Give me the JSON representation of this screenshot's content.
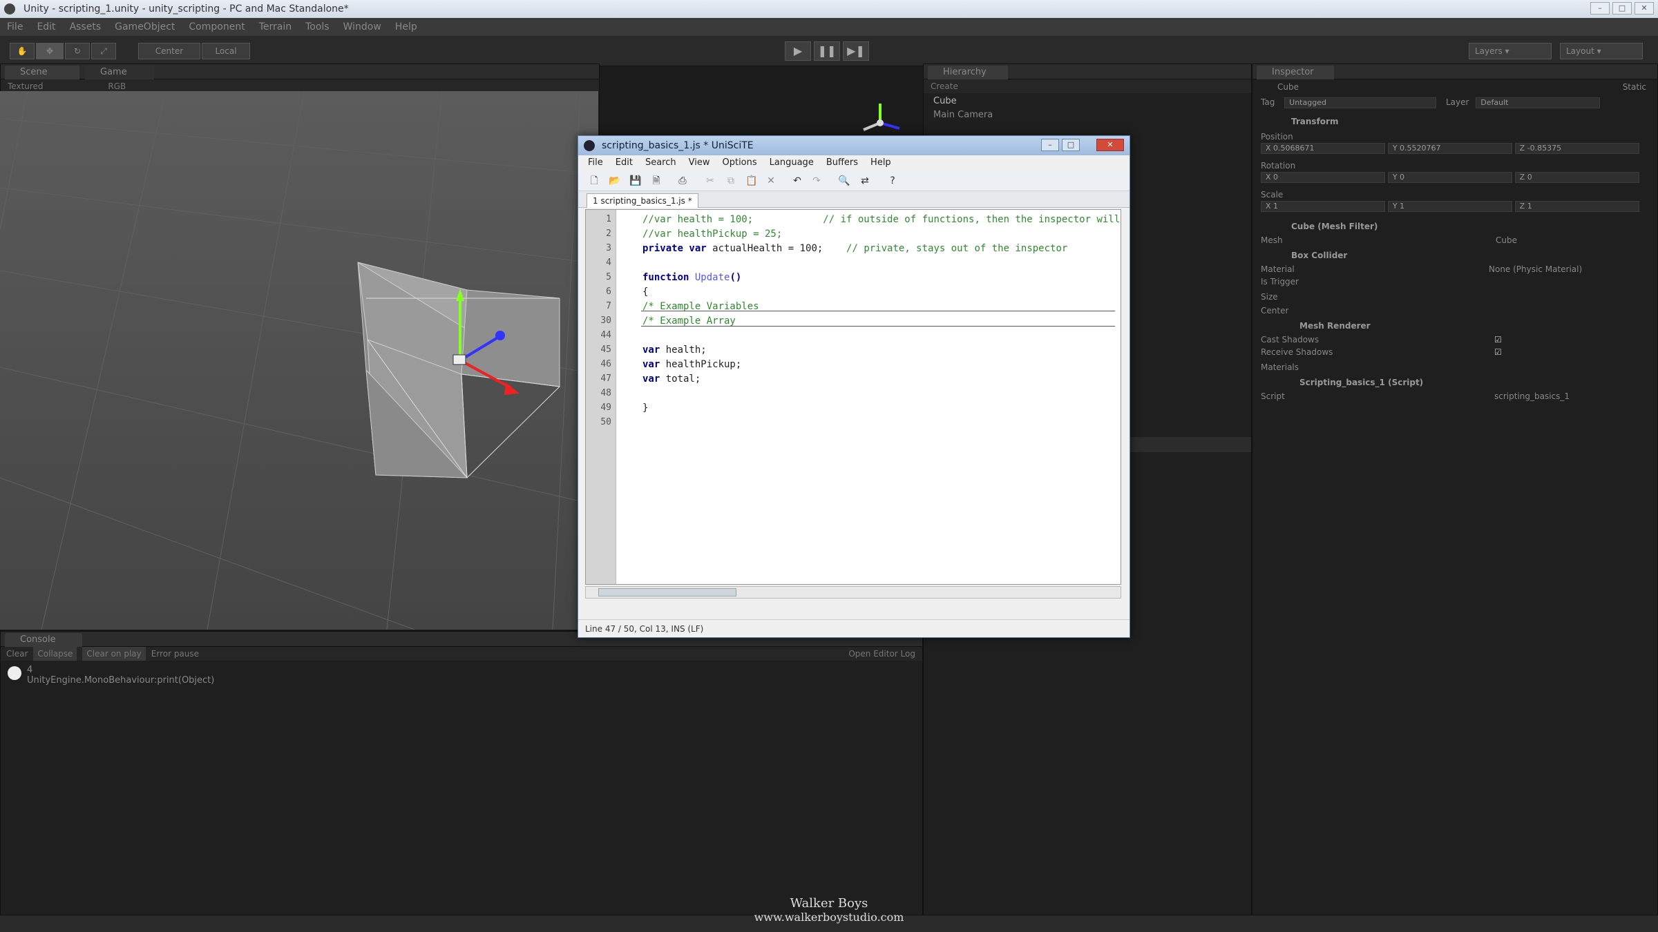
{
  "window": {
    "title": "Unity - scripting_1.unity - unity_scripting - PC and Mac Standalone*"
  },
  "menubar": [
    "File",
    "Edit",
    "Assets",
    "GameObject",
    "Component",
    "Terrain",
    "Tools",
    "Window",
    "Help"
  ],
  "toolbar": {
    "pivot_label": "Center",
    "space_label": "Local",
    "layers_label": "Layers",
    "layout_label": "Layout"
  },
  "scene": {
    "tab_scene": "Scene",
    "tab_game": "Game",
    "draw_mode": "Textured",
    "render_mode": "RGB"
  },
  "hierarchy": {
    "tab": "Hierarchy",
    "create": "Create",
    "items": [
      "Cube",
      "Main Camera"
    ]
  },
  "inspector": {
    "tab": "Inspector",
    "object_name": "Cube",
    "static_label": "Static",
    "tag_label": "Tag",
    "tag_value": "Untagged",
    "layer_label": "Layer",
    "layer_value": "Default",
    "transform": "Transform",
    "position_label": "Position",
    "position": [
      "X 0.5068671",
      "Y 0.5520767",
      "Z -0.85375"
    ],
    "rotation_label": "Rotation",
    "rotation": [
      "X 0",
      "Y 0",
      "Z 0"
    ],
    "scale_label": "Scale",
    "scale": [
      "X 1",
      "Y 1",
      "Z 1"
    ],
    "mesh_filter": "Cube (Mesh Filter)",
    "mesh_label": "Mesh",
    "mesh_value": "Cube",
    "box_collider": "Box Collider",
    "material_label": "Material",
    "material_value": "None (Physic Material)",
    "trigger_label": "Is Trigger",
    "size_label": "Size",
    "center_label": "Center",
    "mesh_renderer": "Mesh Renderer",
    "cast_shadows": "Cast Shadows",
    "receive_shadows": "Receive Shadows",
    "materials_label": "Materials",
    "script_component": "Scripting_basics_1 (Script)",
    "script_label": "Script",
    "script_value": "scripting_basics_1"
  },
  "console": {
    "tab": "Console",
    "buttons": [
      "Clear",
      "Collapse",
      "Clear on play",
      "Error pause"
    ],
    "open_log": "Open Editor Log",
    "entries": [
      {
        "line1": "4",
        "line2": "UnityEngine.MonoBehaviour:print(Object)"
      }
    ]
  },
  "editor": {
    "title": "scripting_basics_1.js * UniSciTE",
    "menu": [
      "File",
      "Edit",
      "Search",
      "View",
      "Options",
      "Language",
      "Buffers",
      "Help"
    ],
    "tab": "1 scripting_basics_1.js *",
    "lines": [
      {
        "num": "1",
        "parts": [
          {
            "t": "//var health = 100;",
            "c": "comment"
          },
          {
            "t": "            // if outside of functions, then the inspector will display it",
            "c": "comment"
          }
        ]
      },
      {
        "num": "2",
        "parts": [
          {
            "t": "//var healthPickup = 25;",
            "c": "comment"
          }
        ]
      },
      {
        "num": "3",
        "parts": [
          {
            "t": "private var ",
            "c": "kw"
          },
          {
            "t": "actualHealth = 100;",
            "c": "plain"
          },
          {
            "t": "    // private, stays out of the inspector",
            "c": "comment"
          }
        ]
      },
      {
        "num": "4",
        "parts": []
      },
      {
        "num": "5",
        "parts": [
          {
            "t": "function ",
            "c": "kw"
          },
          {
            "t": "Update",
            "c": "fn"
          },
          {
            "t": "()",
            "c": "kw"
          }
        ]
      },
      {
        "num": "6",
        "parts": [
          {
            "t": "{",
            "c": "plain"
          }
        ]
      },
      {
        "num": "7",
        "parts": [
          {
            "t": "/* Example Variables",
            "c": "comment"
          }
        ]
      },
      {
        "num": "30",
        "parts": [
          {
            "t": "/* Example Array",
            "c": "comment"
          }
        ]
      },
      {
        "num": "44",
        "parts": []
      },
      {
        "num": "45",
        "parts": [
          {
            "t": "var ",
            "c": "kw"
          },
          {
            "t": "health;",
            "c": "plain"
          }
        ]
      },
      {
        "num": "46",
        "parts": [
          {
            "t": "var ",
            "c": "kw"
          },
          {
            "t": "healthPickup;",
            "c": "plain"
          }
        ]
      },
      {
        "num": "47",
        "parts": [
          {
            "t": "var ",
            "c": "kw"
          },
          {
            "t": "total;",
            "c": "plain"
          }
        ]
      },
      {
        "num": "48",
        "parts": []
      },
      {
        "num": "49",
        "parts": [
          {
            "t": "}",
            "c": "plain"
          }
        ]
      },
      {
        "num": "50",
        "parts": []
      }
    ],
    "status": "Line 47 / 50, Col 13, INS (LF)"
  },
  "watermark": {
    "name": "Walker Boys",
    "url": "www.walkerboystudio.com"
  }
}
